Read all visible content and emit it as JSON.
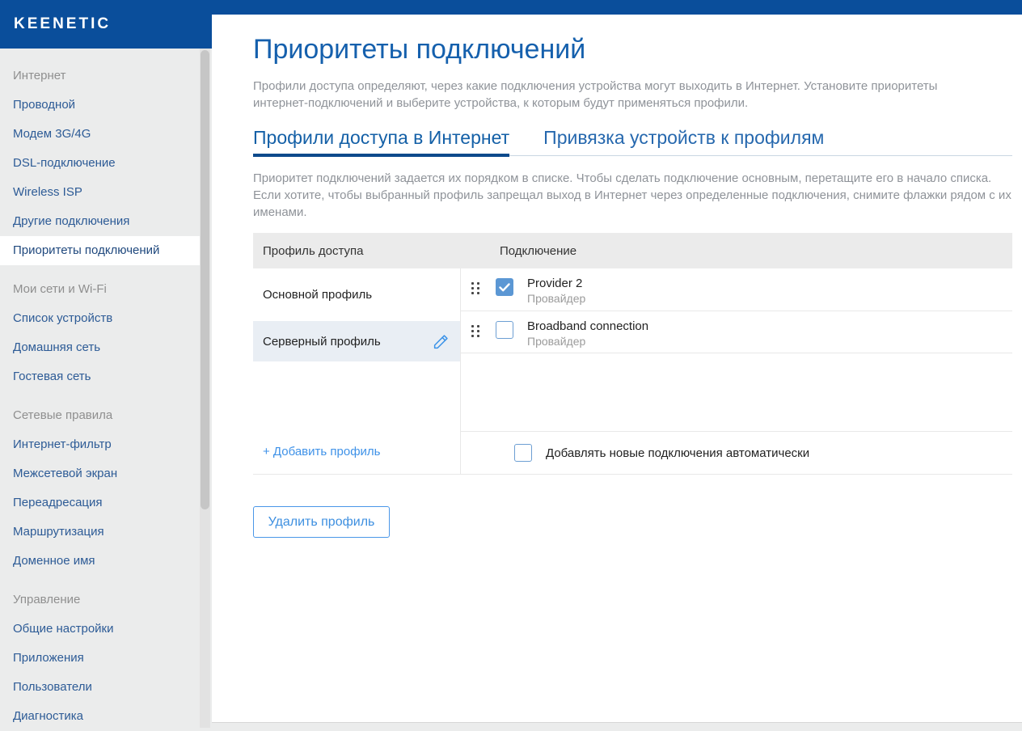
{
  "brand": {
    "logo_text": "KEENETIC"
  },
  "colors": {
    "primary_blue": "#0a4e9b",
    "title_blue": "#1560ad",
    "accent_blue": "#3f92e8",
    "sidebar_link_blue": "#2d5b96",
    "checkbox_checked": "#5b97d4",
    "selected_row_bg": "#e9eef4",
    "table_header_bg": "#ebebeb"
  },
  "sidebar": {
    "groups": [
      {
        "header": "Интернет",
        "items": [
          {
            "label": "Проводной",
            "active": false
          },
          {
            "label": "Модем 3G/4G",
            "active": false
          },
          {
            "label": "DSL-подключение",
            "active": false
          },
          {
            "label": "Wireless ISP",
            "active": false
          },
          {
            "label": "Другие подключения",
            "active": false
          },
          {
            "label": "Приоритеты подключений",
            "active": true
          }
        ]
      },
      {
        "header": "Мои сети и Wi-Fi",
        "items": [
          {
            "label": "Список устройств",
            "active": false
          },
          {
            "label": "Домашняя сеть",
            "active": false
          },
          {
            "label": "Гостевая сеть",
            "active": false
          }
        ]
      },
      {
        "header": "Сетевые правила",
        "items": [
          {
            "label": "Интернет-фильтр",
            "active": false
          },
          {
            "label": "Межсетевой экран",
            "active": false
          },
          {
            "label": "Переадресация",
            "active": false
          },
          {
            "label": "Маршрутизация",
            "active": false
          },
          {
            "label": "Доменное имя",
            "active": false
          }
        ]
      },
      {
        "header": "Управление",
        "items": [
          {
            "label": "Общие настройки",
            "active": false
          },
          {
            "label": "Приложения",
            "active": false
          },
          {
            "label": "Пользователи",
            "active": false
          },
          {
            "label": "Диагностика",
            "active": false
          }
        ]
      }
    ]
  },
  "page": {
    "title": "Приоритеты подключений",
    "intro": "Профили доступа определяют, через какие подключения устройства могут выходить в Интернет. Установите приоритеты интернет-подключений и выберите устройства, к которым будут применяться профили.",
    "tabs": [
      {
        "label": "Профили доступа в Интернет",
        "active": true
      },
      {
        "label": "Привязка устройств к профилям",
        "active": false
      }
    ],
    "tab_description": "Приоритет подключений задается их порядком в списке. Чтобы сделать подключение основным, перетащите его в начало списка. Если хотите, чтобы выбранный профиль запрещал выход в Интернет через определенные подключения, снимите флажки рядом с их именами."
  },
  "table": {
    "columns": [
      "Профиль доступа",
      "Подключение"
    ],
    "profiles": [
      {
        "name": "Основной профиль",
        "selected": false
      },
      {
        "name": "Серверный профиль",
        "selected": true
      }
    ],
    "connections": [
      {
        "name": "Provider 2",
        "type": "Провайдер",
        "checked": true
      },
      {
        "name": "Broadband connection",
        "type": "Провайдер",
        "checked": false
      }
    ],
    "auto_add": {
      "label": "Добавлять новые подключения автоматически",
      "checked": false
    },
    "add_profile_label": "+ Добавить профиль"
  },
  "actions": {
    "delete_profile_label": "Удалить профиль"
  }
}
